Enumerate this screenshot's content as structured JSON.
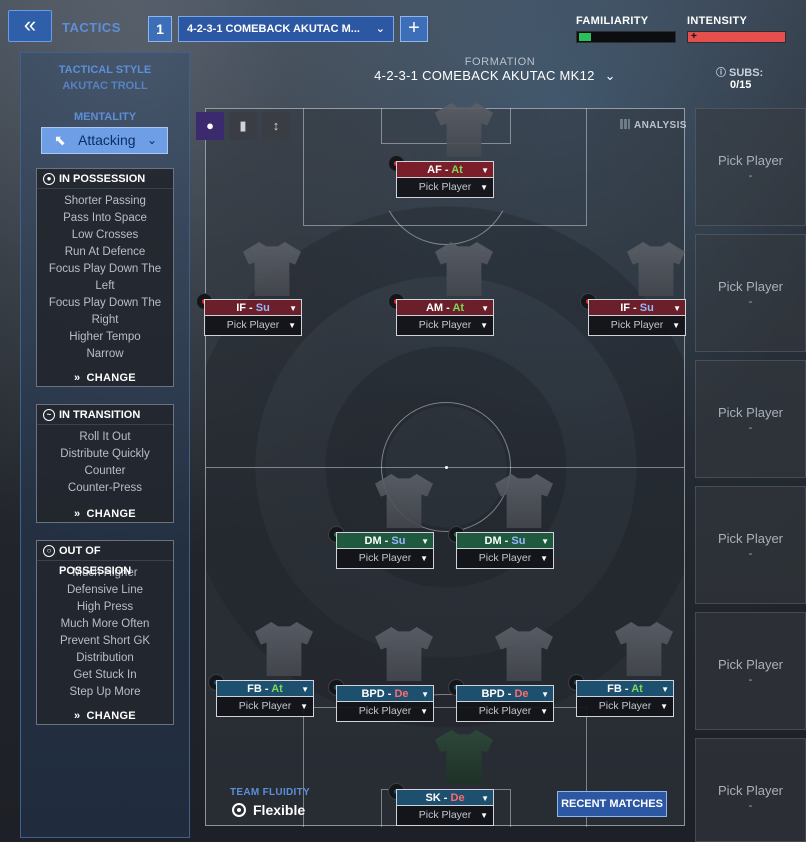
{
  "header": {
    "back_icon": "«",
    "tactics_label": "TACTICS",
    "tactic_number": "1",
    "tactic_name": "4-2-3-1 COMEBACK AKUTAC M...",
    "add_icon": "+",
    "familiarity_label": "FAMILIARITY",
    "intensity_label": "INTENSITY",
    "familiarity_level": 0.12,
    "intensity_level": 1.0,
    "intensity_icon": "+",
    "formation_caption": "FORMATION",
    "formation_name": "4-2-3-1 COMEBACK AKUTAC MK12",
    "subs_caption": "SUBS:",
    "subs_value": "0/15"
  },
  "left": {
    "tactical_style_caption": "TACTICAL STYLE",
    "tactical_style_value": "AKUTAC TROLL",
    "mentality_caption": "MENTALITY",
    "mentality_value": "Attacking",
    "in_possession": {
      "title": "IN POSSESSION",
      "items": [
        "Shorter Passing",
        "Pass Into Space",
        "Low Crosses",
        "Run At Defence",
        "Focus Play Down The",
        "Left",
        "Focus Play Down The",
        "Right",
        "Higher Tempo",
        "Narrow"
      ],
      "change_label": "CHANGE"
    },
    "in_transition": {
      "title": "IN TRANSITION",
      "items": [
        "Roll It Out",
        "Distribute Quickly",
        "Counter",
        "Counter-Press"
      ],
      "change_label": "CHANGE"
    },
    "out_of_possession": {
      "title": "OUT OF POSSESSION",
      "items": [
        "Much Higher",
        "Defensive Line",
        "High Press",
        "Much More Often",
        "Prevent Short GK",
        "Distribution",
        "Get Stuck In",
        "Step Up More"
      ],
      "change_label": "CHANGE"
    }
  },
  "pitch": {
    "analysis_label": "ANALYSIS",
    "positions": [
      {
        "id": "af",
        "pos": "AF",
        "duty": "At",
        "pick": "Pick Player"
      },
      {
        "id": "ifl",
        "pos": "IF",
        "duty": "Su",
        "pick": "Pick Player"
      },
      {
        "id": "am",
        "pos": "AM",
        "duty": "At",
        "pick": "Pick Player"
      },
      {
        "id": "ifr",
        "pos": "IF",
        "duty": "Su",
        "pick": "Pick Player"
      },
      {
        "id": "dml",
        "pos": "DM",
        "duty": "Su",
        "pick": "Pick Player"
      },
      {
        "id": "dmr",
        "pos": "DM",
        "duty": "Su",
        "pick": "Pick Player"
      },
      {
        "id": "fbl",
        "pos": "FB",
        "duty": "At",
        "pick": "Pick Player"
      },
      {
        "id": "bpdl",
        "pos": "BPD",
        "duty": "De",
        "pick": "Pick Player"
      },
      {
        "id": "bpdr",
        "pos": "BPD",
        "duty": "De",
        "pick": "Pick Player"
      },
      {
        "id": "fbr",
        "pos": "FB",
        "duty": "At",
        "pick": "Pick Player"
      },
      {
        "id": "sk",
        "pos": "SK",
        "duty": "De",
        "pick": "Pick Player"
      }
    ],
    "separator": " - ",
    "team_fluidity_caption": "TEAM FLUIDITY",
    "team_fluidity_value": "Flexible",
    "recent_matches_label": "RECENT MATCHES"
  },
  "subs": [
    {
      "label": "Pick Player",
      "dash": "-"
    },
    {
      "label": "Pick Player",
      "dash": "-"
    },
    {
      "label": "Pick Player",
      "dash": "-"
    },
    {
      "label": "Pick Player",
      "dash": "-"
    },
    {
      "label": "Pick Player",
      "dash": "-"
    },
    {
      "label": "Pick Player",
      "dash": "-"
    }
  ]
}
